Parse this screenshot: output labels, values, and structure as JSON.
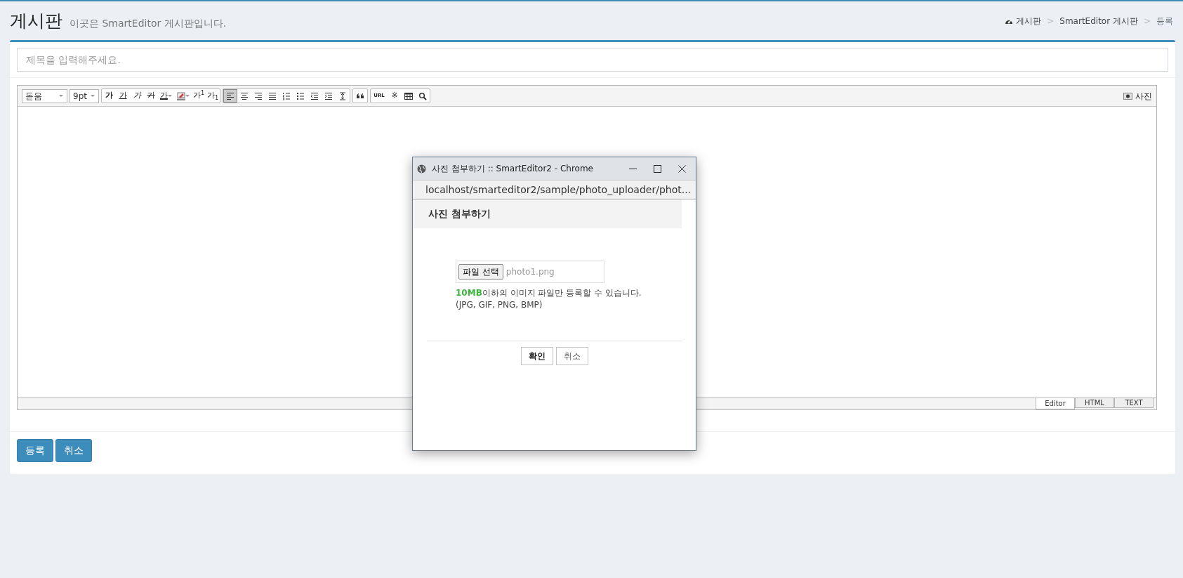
{
  "header": {
    "title": "게시판",
    "subtitle": "이곳은 SmartEditor 게시판입니다.",
    "breadcrumb": [
      {
        "kind": "home",
        "label": "게시판"
      },
      {
        "kind": "sep",
        "label": ">"
      },
      {
        "kind": "link",
        "label": "SmartEditor 게시판"
      },
      {
        "kind": "sep",
        "label": ">"
      },
      {
        "kind": "current",
        "label": "등록"
      }
    ]
  },
  "title_field": {
    "placeholder": "제목을 입력해주세요."
  },
  "editor": {
    "font_select": "돋움",
    "size_select": "9pt",
    "toolbar_groups": [
      [
        {
          "kind": "bold",
          "label": "가"
        },
        {
          "kind": "underline",
          "label": "가"
        },
        {
          "kind": "italic",
          "label": "가"
        },
        {
          "kind": "strike",
          "label": "가"
        },
        {
          "kind": "fontcolor",
          "label": "가"
        },
        {
          "kind": "bgcolor"
        },
        {
          "kind": "sup",
          "label": "가$^{1}$"
        },
        {
          "kind": "sub",
          "label": "가$_{1}$"
        }
      ],
      [
        {
          "kind": "alignleft",
          "selected": true
        },
        {
          "kind": "aligncenter",
          "selected": false
        },
        {
          "kind": "alignright",
          "selected": false
        },
        {
          "kind": "justify",
          "selected": false
        },
        {
          "kind": "ol",
          "selected": false
        },
        {
          "kind": "ul",
          "selected": false
        },
        {
          "kind": "outdent",
          "selected": false
        },
        {
          "kind": "indent",
          "selected": false
        },
        {
          "kind": "lineheight",
          "selected": false
        }
      ],
      [
        {
          "kind": "quote"
        }
      ],
      [
        {
          "kind": "url",
          "label": "URL"
        },
        {
          "kind": "char",
          "label": "※"
        },
        {
          "kind": "table"
        },
        {
          "kind": "find"
        }
      ]
    ],
    "photo_button": "사진",
    "mode_tabs": [
      {
        "label": "Editor",
        "selected": true
      },
      {
        "label": "HTML",
        "selected": false
      },
      {
        "label": "TEXT",
        "selected": false
      }
    ]
  },
  "buttons": [
    {
      "label": "등록"
    },
    {
      "label": "취소"
    }
  ],
  "popup": {
    "window_title": "사진 첨부하기 :: SmartEditor2 - Chrome",
    "address": "localhost/smarteditor2/sample/photo_uploader/phot...",
    "heading": "사진 첨부하기",
    "file_button": "파일 선택",
    "file_name": "photo1.png",
    "note": "**10MB**이하의 이미지 파일만 등록할 수 있습니다.",
    "formats": "(JPG, GIF, PNG, BMP)",
    "buttons": [
      {
        "label": "확인",
        "primary": true
      },
      {
        "label": "취소",
        "primary": false
      }
    ]
  }
}
